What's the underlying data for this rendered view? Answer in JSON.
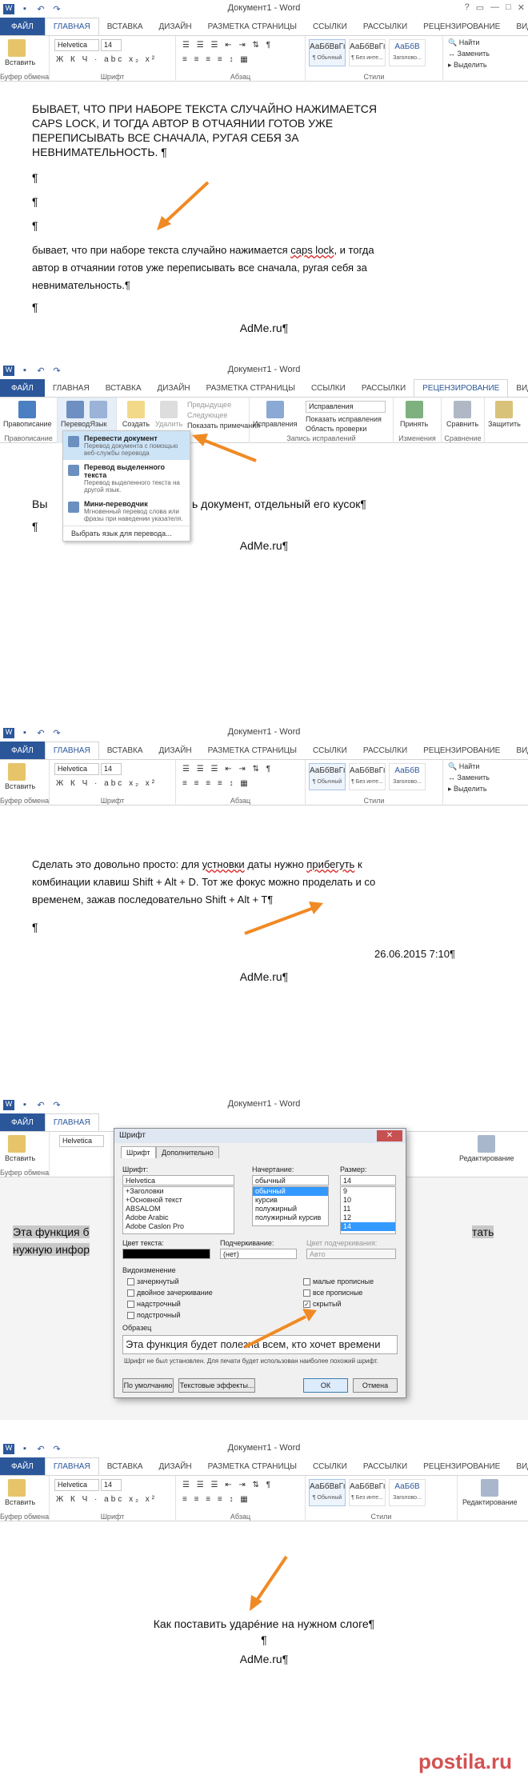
{
  "window": {
    "title": "Документ1 - Word",
    "controls": [
      "?",
      "▭",
      "—",
      "□",
      "✕"
    ]
  },
  "tabs": [
    "ФАЙЛ",
    "ГЛАВНАЯ",
    "ВСТАВКА",
    "ДИЗАЙН",
    "РАЗМЕТКА СТРАНИЦЫ",
    "ССЫЛКИ",
    "РАССЫЛКИ",
    "РЕЦЕНЗИРОВАНИЕ",
    "ВИД"
  ],
  "home_ribbon": {
    "paste": "Вставить",
    "clipboard": "Буфер обмена",
    "font_group": "Шрифт",
    "paragraph_group": "Абзац",
    "styles_group": "Стили",
    "editing_group": "Редактирование",
    "font_size": "14",
    "format_row": "Ж К Ч · abc x₂ x²",
    "styles": [
      {
        "sample": "АаБбВвГг,",
        "name": "¶ Обычный"
      },
      {
        "sample": "АаБбВвГг,",
        "name": "¶ Без инте..."
      },
      {
        "sample": "АаБбВ",
        "name": "Заголово..."
      }
    ],
    "find": "Найти",
    "replace": "Заменить",
    "select": "Выделить"
  },
  "panel1": {
    "font": "Helvetica",
    "caps_text": [
      "БЫВАЕТ, ЧТО ПРИ НАБОРЕ ТЕКСТА СЛУЧАЙНО НАЖИМАЕТСЯ",
      "CAPS LOCK, И ТОГДА АВТОР В ОТЧАЯНИИ ГОТОВ УЖЕ",
      "ПЕРЕПИСЫВАТЬ ВСЕ СНАЧАЛА, РУГАЯ СЕБЯ ЗА",
      "НЕВНИМАТЕЛЬНОСТЬ. ¶"
    ],
    "pilcrows": [
      "¶",
      "¶",
      "¶"
    ],
    "normal_text_a": "бывает, что при наборе текста случайно нажимается ",
    "normal_text_caps": "caps lock",
    "normal_text_b": ", и тогда",
    "normal_text_2": "автор в отчаянии готов уже переписывать все сначала, ругая себя за",
    "normal_text_3": "невнимательность.¶",
    "last_pilcrow": "¶",
    "footer": "AdMe.ru¶"
  },
  "panel2": {
    "review_ribbon": {
      "spelling": "Правописание",
      "spelling_group": "Правописание",
      "translate": "Перевод",
      "language": "Язык",
      "create_note": "Создать примечание",
      "delete": "Удалить",
      "prev": "Предыдущее",
      "next": "Следующее",
      "show_notes": "Показать примечания",
      "notes_group": "Примечания",
      "track": "Исправления",
      "track_mode": "Исправления",
      "show_markup": "Показать исправления",
      "review_pane": "Область проверки",
      "tracking_group": "Запись исправлений",
      "accept": "Принять",
      "changes_group": "Изменения",
      "compare": "Сравнить",
      "compare_group": "Сравнение",
      "protect": "Защитить"
    },
    "menu": [
      {
        "title": "Перевести документ",
        "desc": "Перевод документа с помощью веб-службы перевода"
      },
      {
        "title": "Перевод выделенного текста",
        "desc": "Перевод выделенного текста на другой язык."
      },
      {
        "title": "Мини-переводчик",
        "desc": "Мгновенный перевод слова или фразы при наведении указателя."
      }
    ],
    "menu_footer": "Выбрать язык для перевода...",
    "text_left": "Вы",
    "text_right": "ь документ, отдельный его кусок¶",
    "pilcrow": "¶",
    "footer": "AdMe.ru¶"
  },
  "panel3": {
    "font": "Helvetica",
    "line1_a": "Сделать это довольно просто: для ",
    "line1_err1": "устновки",
    "line1_b": " даты нужно ",
    "line1_err2": "прибегуть",
    "line1_c": " к",
    "line2": "комбинации клавиш Shift + Alt + D. Тот же фокус можно проделать и со",
    "line3": "временем, зажав последовательно Shift + Alt + T¶",
    "pilcrow": "¶",
    "date": "26.06.2015 7:10¶",
    "footer": "AdMe.ru¶"
  },
  "panel4": {
    "font": "Helvetica",
    "dialog_title": "Шрифт",
    "tab_font": "Шрифт",
    "tab_advanced": "Дополнительно",
    "font_label": "Шрифт:",
    "font_value": "Helvetica",
    "font_list": [
      "+Заголовки",
      "+Основной текст",
      "ABSALOM",
      "Adobe Arabic",
      "Adobe Caslon Pro"
    ],
    "style_label": "Начертание:",
    "style_value": "обычный",
    "style_list": [
      "обычный",
      "курсив",
      "полужирный",
      "полужирный курсив"
    ],
    "size_label": "Размер:",
    "size_value": "14",
    "size_list": [
      "9",
      "10",
      "11",
      "12",
      "14"
    ],
    "color_label": "Цвет текста:",
    "underline_label": "Подчеркивание:",
    "underline_value": "(нет)",
    "underline_color_label": "Цвет подчеркивания:",
    "underline_color_value": "Авто",
    "effects_label": "Видоизменение",
    "effects_left": [
      "зачеркнутый",
      "двойное зачеркивание",
      "надстрочный",
      "подстрочный"
    ],
    "effects_right": [
      "малые прописные",
      "все прописные",
      "скрытый"
    ],
    "sample_label": "Образец",
    "sample_text": "Эта функция будет полезна всем, кто хочет времени",
    "sample_note": "Шрифт не был установлен. Для печати будет использован наиболее похожий шрифт.",
    "btn_default": "По умолчанию",
    "btn_effects": "Текстовые эффекты...",
    "btn_ok": "ОК",
    "btn_cancel": "Отмена",
    "doc_text_1": "Эта функция б",
    "doc_text_1b": "тать",
    "doc_text_2": "нужную инфор",
    "editing_group": "Редактирование"
  },
  "panel5": {
    "font": "Helvetica",
    "line1": "Как поставить ударéние на нужном слоге¶",
    "pilcrow": "¶",
    "footer": "AdMe.ru¶"
  },
  "watermark": "postila.ru",
  "colors": {
    "accent": "#2b579a",
    "arrow": "#f08a24",
    "watermark": "#cc3333"
  }
}
